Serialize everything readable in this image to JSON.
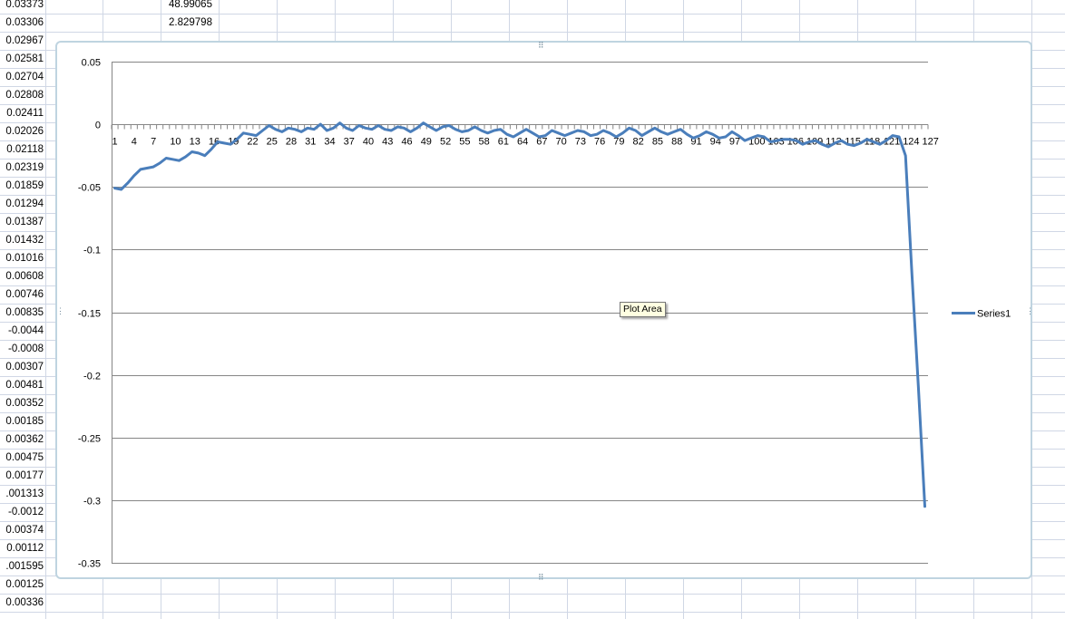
{
  "sheet": {
    "column_a_values": [
      "0.03373",
      "0.03306",
      "0.02967",
      "0.02581",
      "0.02704",
      "0.02808",
      "0.02411",
      "0.02026",
      "0.02118",
      "0.02319",
      "0.01859",
      "0.01294",
      "0.01387",
      "0.01432",
      "0.01016",
      "0.00608",
      "0.00746",
      "0.00835",
      "-0.0044",
      "-0.0008",
      "0.00307",
      "0.00481",
      "0.00352",
      "0.00185",
      "0.00362",
      "0.00475",
      "0.00177",
      ".001313",
      "-0.0012",
      "0.00374",
      "0.00112",
      ".001595",
      "0.00125",
      "0.00336"
    ],
    "column_c_values": [
      "48.99065",
      "2.829798"
    ]
  },
  "tooltip": {
    "text": "Plot Area"
  },
  "colors": {
    "series": "#4a7ebb",
    "gridline": "#868686",
    "cell_grid": "#d0d7e5",
    "chart_border": "#bfd4e0"
  },
  "chart_data": {
    "type": "line",
    "ylim": [
      -0.35,
      0.05
    ],
    "y_ticks": [
      "0.05",
      "0",
      "-0.05",
      "-0.1",
      "-0.15",
      "-0.2",
      "-0.25",
      "-0.3",
      "-0.35"
    ],
    "x_tick_labels": [
      "1",
      "4",
      "7",
      "10",
      "13",
      "16",
      "19",
      "22",
      "25",
      "28",
      "31",
      "34",
      "37",
      "40",
      "43",
      "46",
      "49",
      "52",
      "55",
      "58",
      "61",
      "64",
      "67",
      "70",
      "73",
      "76",
      "79",
      "82",
      "85",
      "88",
      "91",
      "94",
      "97",
      "100",
      "103",
      "106",
      "109",
      "112",
      "115",
      "118",
      "121",
      "124",
      "127"
    ],
    "legend": {
      "position": "right"
    },
    "grid": true,
    "series": [
      {
        "name": "Series1",
        "x_start": 1,
        "values": [
          -0.051,
          -0.052,
          -0.047,
          -0.041,
          -0.036,
          -0.035,
          -0.034,
          -0.031,
          -0.027,
          -0.028,
          -0.029,
          -0.026,
          -0.022,
          -0.023,
          -0.025,
          -0.02,
          -0.014,
          -0.015,
          -0.016,
          -0.012,
          -0.007,
          -0.008,
          -0.009,
          -0.005,
          -0.001,
          -0.004,
          -0.006,
          -0.003,
          -0.004,
          -0.006,
          -0.003,
          -0.004,
          0.0,
          -0.005,
          -0.003,
          0.001,
          -0.003,
          -0.005,
          -0.001,
          -0.003,
          -0.004,
          -0.001,
          -0.004,
          -0.005,
          -0.002,
          -0.003,
          -0.006,
          -0.003,
          0.001,
          -0.002,
          -0.005,
          -0.002,
          -0.001,
          -0.004,
          -0.006,
          -0.005,
          -0.002,
          -0.005,
          -0.007,
          -0.005,
          -0.004,
          -0.008,
          -0.01,
          -0.007,
          -0.004,
          -0.007,
          -0.01,
          -0.009,
          -0.005,
          -0.007,
          -0.009,
          -0.007,
          -0.005,
          -0.006,
          -0.009,
          -0.008,
          -0.005,
          -0.007,
          -0.01,
          -0.007,
          -0.003,
          -0.005,
          -0.009,
          -0.006,
          -0.003,
          -0.006,
          -0.008,
          -0.006,
          -0.004,
          -0.008,
          -0.011,
          -0.009,
          -0.006,
          -0.008,
          -0.011,
          -0.01,
          -0.006,
          -0.009,
          -0.013,
          -0.011,
          -0.009,
          -0.01,
          -0.014,
          -0.013,
          -0.012,
          -0.012,
          -0.013,
          -0.016,
          -0.014,
          -0.013,
          -0.016,
          -0.018,
          -0.015,
          -0.013,
          -0.016,
          -0.017,
          -0.015,
          -0.012,
          -0.014,
          -0.016,
          -0.013,
          -0.009,
          -0.01,
          -0.025,
          -0.12,
          -0.21,
          -0.305
        ]
      }
    ]
  }
}
